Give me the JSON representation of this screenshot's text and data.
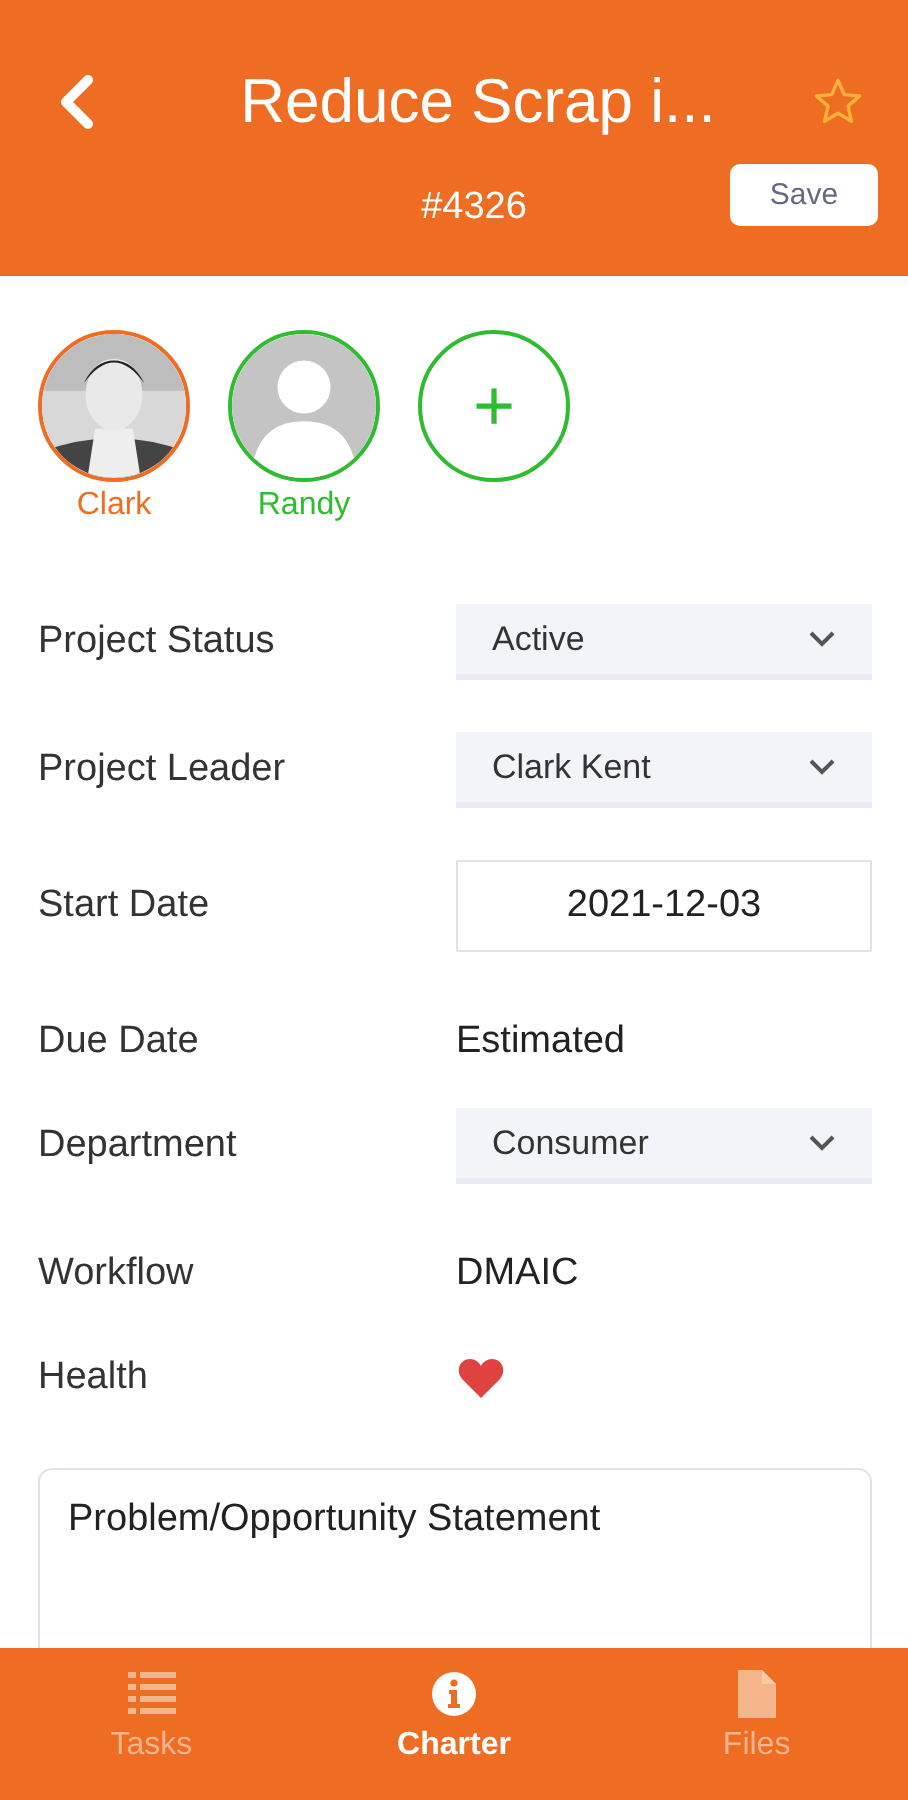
{
  "header": {
    "title": "Reduce Scrap i...",
    "number": "#4326",
    "favorite": false,
    "save_label": "Save"
  },
  "members": [
    {
      "name": "Clark",
      "color": "#ee6d22"
    },
    {
      "name": "Randy",
      "kind": "placeholder",
      "color": "#2ebd2e"
    }
  ],
  "add_member": {
    "label": "+"
  },
  "fields": [
    {
      "label": "Project Status",
      "kind": "select",
      "value": "Active"
    },
    {
      "label": "Project Leader",
      "kind": "select",
      "value": "Clark Kent"
    },
    {
      "label": "Start Date",
      "kind": "date",
      "value": "2021-12-03"
    },
    {
      "label": "Due Date",
      "kind": "text",
      "value": "Estimated"
    },
    {
      "label": "Department",
      "kind": "select",
      "value": "Consumer"
    },
    {
      "label": "Workflow",
      "kind": "text",
      "value": "DMAIC"
    },
    {
      "label": "Health",
      "kind": "heart"
    }
  ],
  "statement": {
    "title": "Problem/Opportunity Statement"
  },
  "tabs": [
    {
      "label": "Tasks",
      "kind": "list",
      "selected": false
    },
    {
      "label": "Charter",
      "kind": "info",
      "selected": true
    },
    {
      "label": "Files",
      "kind": "file",
      "selected": false
    }
  ]
}
